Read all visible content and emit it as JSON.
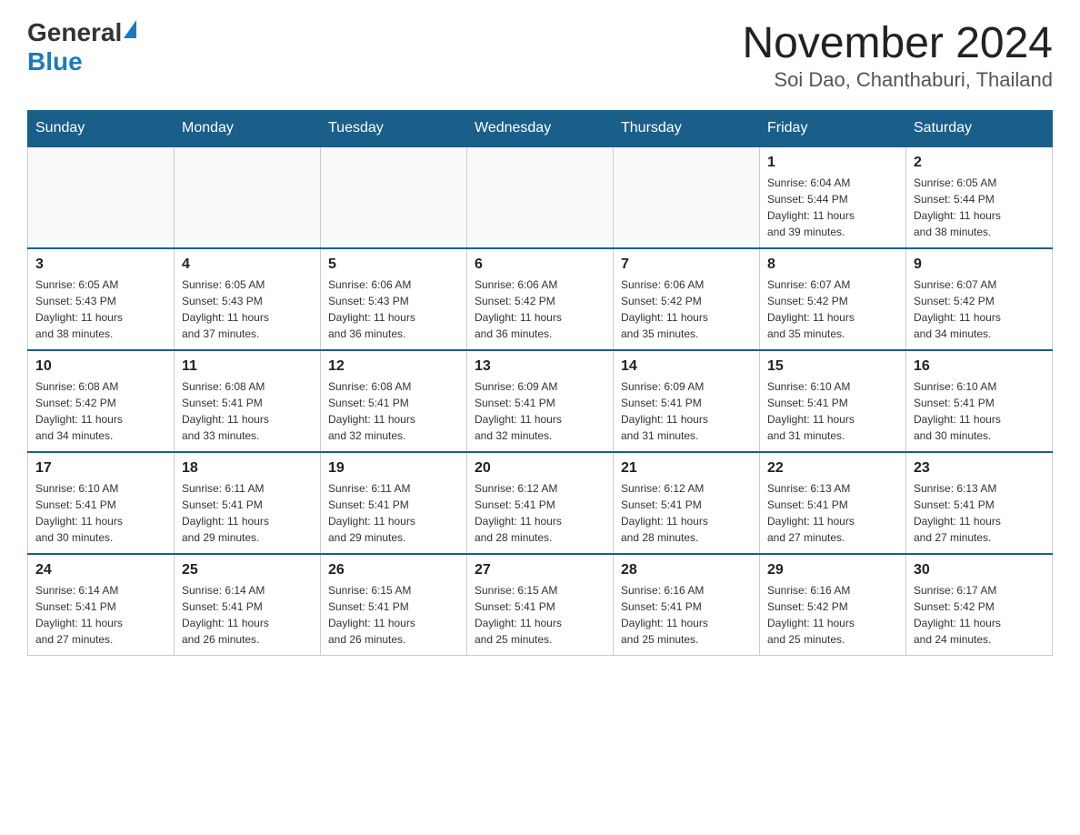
{
  "header": {
    "logo_general": "General",
    "logo_blue": "Blue",
    "title": "November 2024",
    "subtitle": "Soi Dao, Chanthaburi, Thailand"
  },
  "calendar": {
    "days_of_week": [
      "Sunday",
      "Monday",
      "Tuesday",
      "Wednesday",
      "Thursday",
      "Friday",
      "Saturday"
    ],
    "weeks": [
      [
        {
          "day": "",
          "info": ""
        },
        {
          "day": "",
          "info": ""
        },
        {
          "day": "",
          "info": ""
        },
        {
          "day": "",
          "info": ""
        },
        {
          "day": "",
          "info": ""
        },
        {
          "day": "1",
          "info": "Sunrise: 6:04 AM\nSunset: 5:44 PM\nDaylight: 11 hours\nand 39 minutes."
        },
        {
          "day": "2",
          "info": "Sunrise: 6:05 AM\nSunset: 5:44 PM\nDaylight: 11 hours\nand 38 minutes."
        }
      ],
      [
        {
          "day": "3",
          "info": "Sunrise: 6:05 AM\nSunset: 5:43 PM\nDaylight: 11 hours\nand 38 minutes."
        },
        {
          "day": "4",
          "info": "Sunrise: 6:05 AM\nSunset: 5:43 PM\nDaylight: 11 hours\nand 37 minutes."
        },
        {
          "day": "5",
          "info": "Sunrise: 6:06 AM\nSunset: 5:43 PM\nDaylight: 11 hours\nand 36 minutes."
        },
        {
          "day": "6",
          "info": "Sunrise: 6:06 AM\nSunset: 5:42 PM\nDaylight: 11 hours\nand 36 minutes."
        },
        {
          "day": "7",
          "info": "Sunrise: 6:06 AM\nSunset: 5:42 PM\nDaylight: 11 hours\nand 35 minutes."
        },
        {
          "day": "8",
          "info": "Sunrise: 6:07 AM\nSunset: 5:42 PM\nDaylight: 11 hours\nand 35 minutes."
        },
        {
          "day": "9",
          "info": "Sunrise: 6:07 AM\nSunset: 5:42 PM\nDaylight: 11 hours\nand 34 minutes."
        }
      ],
      [
        {
          "day": "10",
          "info": "Sunrise: 6:08 AM\nSunset: 5:42 PM\nDaylight: 11 hours\nand 34 minutes."
        },
        {
          "day": "11",
          "info": "Sunrise: 6:08 AM\nSunset: 5:41 PM\nDaylight: 11 hours\nand 33 minutes."
        },
        {
          "day": "12",
          "info": "Sunrise: 6:08 AM\nSunset: 5:41 PM\nDaylight: 11 hours\nand 32 minutes."
        },
        {
          "day": "13",
          "info": "Sunrise: 6:09 AM\nSunset: 5:41 PM\nDaylight: 11 hours\nand 32 minutes."
        },
        {
          "day": "14",
          "info": "Sunrise: 6:09 AM\nSunset: 5:41 PM\nDaylight: 11 hours\nand 31 minutes."
        },
        {
          "day": "15",
          "info": "Sunrise: 6:10 AM\nSunset: 5:41 PM\nDaylight: 11 hours\nand 31 minutes."
        },
        {
          "day": "16",
          "info": "Sunrise: 6:10 AM\nSunset: 5:41 PM\nDaylight: 11 hours\nand 30 minutes."
        }
      ],
      [
        {
          "day": "17",
          "info": "Sunrise: 6:10 AM\nSunset: 5:41 PM\nDaylight: 11 hours\nand 30 minutes."
        },
        {
          "day": "18",
          "info": "Sunrise: 6:11 AM\nSunset: 5:41 PM\nDaylight: 11 hours\nand 29 minutes."
        },
        {
          "day": "19",
          "info": "Sunrise: 6:11 AM\nSunset: 5:41 PM\nDaylight: 11 hours\nand 29 minutes."
        },
        {
          "day": "20",
          "info": "Sunrise: 6:12 AM\nSunset: 5:41 PM\nDaylight: 11 hours\nand 28 minutes."
        },
        {
          "day": "21",
          "info": "Sunrise: 6:12 AM\nSunset: 5:41 PM\nDaylight: 11 hours\nand 28 minutes."
        },
        {
          "day": "22",
          "info": "Sunrise: 6:13 AM\nSunset: 5:41 PM\nDaylight: 11 hours\nand 27 minutes."
        },
        {
          "day": "23",
          "info": "Sunrise: 6:13 AM\nSunset: 5:41 PM\nDaylight: 11 hours\nand 27 minutes."
        }
      ],
      [
        {
          "day": "24",
          "info": "Sunrise: 6:14 AM\nSunset: 5:41 PM\nDaylight: 11 hours\nand 27 minutes."
        },
        {
          "day": "25",
          "info": "Sunrise: 6:14 AM\nSunset: 5:41 PM\nDaylight: 11 hours\nand 26 minutes."
        },
        {
          "day": "26",
          "info": "Sunrise: 6:15 AM\nSunset: 5:41 PM\nDaylight: 11 hours\nand 26 minutes."
        },
        {
          "day": "27",
          "info": "Sunrise: 6:15 AM\nSunset: 5:41 PM\nDaylight: 11 hours\nand 25 minutes."
        },
        {
          "day": "28",
          "info": "Sunrise: 6:16 AM\nSunset: 5:41 PM\nDaylight: 11 hours\nand 25 minutes."
        },
        {
          "day": "29",
          "info": "Sunrise: 6:16 AM\nSunset: 5:42 PM\nDaylight: 11 hours\nand 25 minutes."
        },
        {
          "day": "30",
          "info": "Sunrise: 6:17 AM\nSunset: 5:42 PM\nDaylight: 11 hours\nand 24 minutes."
        }
      ]
    ]
  }
}
